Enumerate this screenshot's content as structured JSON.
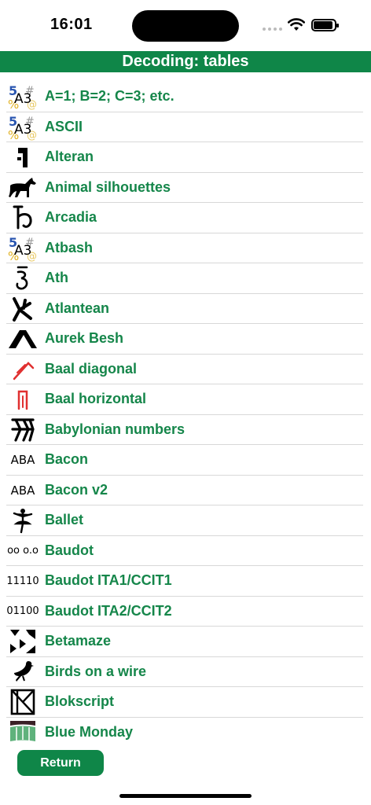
{
  "status": {
    "time": "16:01"
  },
  "header": {
    "title": "Decoding: tables"
  },
  "items": [
    {
      "label": "A=1; B=2; C=3; etc.",
      "icon": "number-letter-icon"
    },
    {
      "label": "ASCII",
      "icon": "number-letter-icon"
    },
    {
      "label": "Alteran",
      "icon": "alteran-glyph-icon"
    },
    {
      "label": "Animal silhouettes",
      "icon": "horse-silhouette-icon"
    },
    {
      "label": "Arcadia",
      "icon": "arcadia-glyph-icon"
    },
    {
      "label": "Atbash",
      "icon": "number-letter-icon"
    },
    {
      "label": "Ath",
      "icon": "ath-glyph-icon"
    },
    {
      "label": "Atlantean",
      "icon": "atlantean-glyph-icon"
    },
    {
      "label": "Aurek Besh",
      "icon": "aurek-besh-glyph-icon"
    },
    {
      "label": "Baal diagonal",
      "icon": "baal-diagonal-icon"
    },
    {
      "label": "Baal horizontal",
      "icon": "baal-horizontal-icon"
    },
    {
      "label": "Babylonian numbers",
      "icon": "cuneiform-icon"
    },
    {
      "label": "Bacon",
      "icon": "aba-text-icon",
      "icon_text": "ABA"
    },
    {
      "label": "Bacon v2",
      "icon": "aba-text-icon",
      "icon_text": "ABA"
    },
    {
      "label": "Ballet",
      "icon": "ballerina-icon"
    },
    {
      "label": "Baudot",
      "icon": "baudot-text-icon",
      "icon_text": "oo o.o"
    },
    {
      "label": "Baudot ITA1/CCIT1",
      "icon": "binary-text-icon",
      "icon_text": "11110"
    },
    {
      "label": "Baudot ITA2/CCIT2",
      "icon": "binary-text-icon",
      "icon_text": "01100"
    },
    {
      "label": "Betamaze",
      "icon": "betamaze-icon"
    },
    {
      "label": "Birds on a wire",
      "icon": "bird-icon"
    },
    {
      "label": "Blokscript",
      "icon": "blokscript-icon"
    },
    {
      "label": "Blue Monday",
      "icon": "blue-monday-icon"
    }
  ],
  "footer": {
    "return_label": "Return"
  },
  "colors": {
    "accent": "#0f8648",
    "label": "#15864a"
  }
}
